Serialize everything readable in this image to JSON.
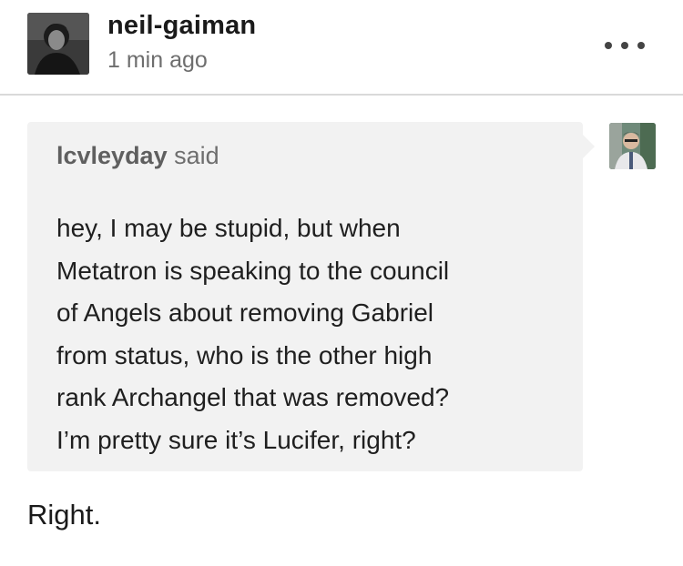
{
  "post": {
    "blog_name": "neil-gaiman",
    "time": "1 min ago",
    "more_icon": "ellipsis-icon"
  },
  "question": {
    "asker": "lcvleyday",
    "said": " said",
    "lines": [
      "hey, I may be stupid, but when",
      "Metatron is speaking to the council",
      "of Angels about removing Gabriel",
      "from status, who is the other high",
      "rank Archangel that was removed?",
      "I’m pretty sure it’s Lucifer, right?"
    ],
    "bubble_color": "#f2f2f2"
  },
  "answer": {
    "text": "Right."
  }
}
